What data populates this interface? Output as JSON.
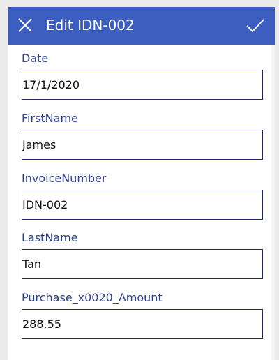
{
  "header": {
    "title": "Edit IDN-002",
    "background": "#3b5ec0"
  },
  "fields": [
    {
      "label": "Date",
      "value": "17/1/2020"
    },
    {
      "label": "FirstName",
      "value": "James"
    },
    {
      "label": "InvoiceNumber",
      "value": "IDN-002"
    },
    {
      "label": "LastName",
      "value": "Tan"
    },
    {
      "label": "Purchase_x0020_Amount",
      "value": "288.55"
    }
  ],
  "colors": {
    "label": "#2c3f8f",
    "input_border": "#1f2a5a",
    "background": "#ebebeb"
  }
}
